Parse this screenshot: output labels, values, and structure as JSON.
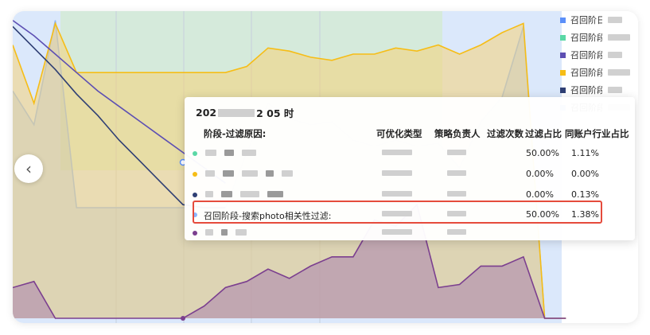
{
  "navigation": {
    "prev_icon": "chevron-left-icon",
    "prev_glyph": "‹"
  },
  "legend": [
    {
      "label": "召回阶日",
      "color": "#5b8ff9"
    },
    {
      "label": "召回阶段",
      "color": "#5ad8a6"
    },
    {
      "label": "召回阶段",
      "color": "#5d4fb3"
    },
    {
      "label": "召回阶段",
      "color": "#f6bd16"
    },
    {
      "label": "召回阶段",
      "color": "#2f3f74"
    },
    {
      "label": "召回阶段",
      "color": "#8bb6ff"
    }
  ],
  "tooltip": {
    "title_prefix": "202",
    "title_suffix": "2 05 时",
    "headers": {
      "stage_reason": "阶段-过滤原因:",
      "opt_type": "可优化类型",
      "owner": "策略负责人",
      "filter_count": "过滤次数",
      "filter_ratio": "过滤占比",
      "industry_ratio": "同账户行业占比"
    },
    "rows": [
      {
        "color": "#5ad8a6",
        "filter_ratio": "50.00%",
        "industry_ratio": "1.11%"
      },
      {
        "color": "#f6bd16",
        "filter_ratio": "0.00%",
        "industry_ratio": "0.00%"
      },
      {
        "color": "#2f3f74",
        "filter_ratio": "0.00%",
        "industry_ratio": "0.13%"
      },
      {
        "color": "#8bb6ff",
        "text": "召回阶段-搜索photo相关性过滤:",
        "filter_ratio": "50.00%",
        "industry_ratio": "1.38%"
      },
      {
        "color": "#7b3f8f",
        "filter_ratio": "",
        "industry_ratio": ""
      }
    ]
  },
  "chart_data": {
    "type": "area",
    "x": [
      0,
      1,
      2,
      3,
      4,
      5,
      6,
      7,
      8,
      9,
      10,
      11,
      12,
      13,
      14,
      15,
      16,
      17,
      18,
      19,
      20,
      21,
      22,
      23,
      24,
      25,
      26
    ],
    "series": [
      {
        "color": "#8bb6ff",
        "values": [
          74,
          63,
          97,
          36,
          36,
          36,
          36,
          36,
          36,
          36,
          36,
          54,
          70,
          65,
          63,
          64,
          58,
          56,
          58,
          56,
          57,
          49,
          64,
          72,
          95,
          0,
          0
        ]
      },
      {
        "color": "#f6bd16",
        "values": [
          89,
          70,
          96,
          80,
          80,
          80,
          80,
          80,
          80,
          80,
          80,
          82,
          88,
          87,
          85,
          84,
          86,
          86,
          88,
          87,
          89,
          86,
          89,
          93,
          96,
          0,
          0
        ]
      },
      {
        "color": "#7b3f8f",
        "values": [
          10,
          12,
          0,
          0,
          0,
          0,
          0,
          0,
          0,
          4,
          10,
          12,
          16,
          13,
          17,
          20,
          20,
          32,
          30,
          37,
          10,
          11,
          17,
          17,
          20,
          0,
          0
        ]
      },
      {
        "color": "#5d4fb3",
        "values": [
          97,
          92,
          86,
          80,
          74,
          69,
          64,
          59,
          54,
          49,
          44,
          0,
          0,
          0,
          0,
          0,
          0,
          0,
          0,
          0,
          0,
          0,
          0,
          0,
          0,
          0,
          0
        ]
      },
      {
        "color": "#2f3f74",
        "values": [
          95,
          88,
          81,
          73,
          66,
          58,
          51,
          44,
          37,
          36,
          36,
          0,
          0,
          0,
          0,
          0,
          0,
          0,
          0,
          0,
          0,
          0,
          0,
          0,
          0,
          0,
          0
        ]
      }
    ],
    "ylim": [
      0,
      100
    ]
  }
}
